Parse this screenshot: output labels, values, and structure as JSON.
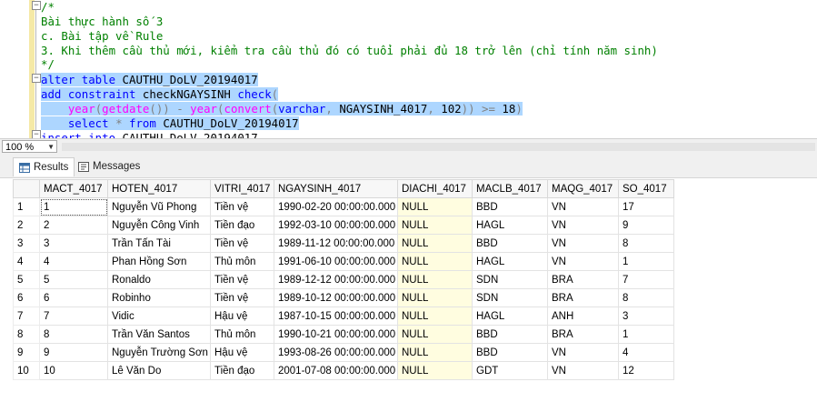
{
  "editor": {
    "lines": [
      {
        "text": "/*",
        "style": "cmt",
        "selected": false
      },
      {
        "text": "Bài thực hành số 3",
        "style": "cmt",
        "selected": false
      },
      {
        "text": "c. Bài tập về Rule",
        "style": "cmt",
        "selected": false
      },
      {
        "text": "3. Khi thêm cầu thủ mới, kiểm tra cầu thủ đó có tuổi phải đủ 18 trở lên (chỉ tính năm sinh)",
        "style": "cmt",
        "selected": false
      },
      {
        "text": "*/",
        "style": "cmt",
        "selected": false
      }
    ],
    "sql": {
      "l1_kw": "alter table",
      "l1_obj": "CAUTHU_DoLV_20194017",
      "l2_kw": "add constraint",
      "l2_obj": "checkNGAYSINH",
      "l2_kw2": "check",
      "l2_paren": "(",
      "l3_fn1": "year",
      "l3_p1": "(",
      "l3_fn2": "getdate",
      "l3_p2": "())",
      "l3_op": "-",
      "l3_fn3": "year",
      "l3_p3": "(",
      "l3_fn4": "convert",
      "l3_p4": "(",
      "l3_kw": "varchar",
      "l3_p5": ",",
      "l3_obj": "NGAYSINH_4017",
      "l3_p6": ",",
      "l3_num": "102",
      "l3_p7": "))",
      "l3_ge": ">=",
      "l3_num2": "18",
      "l3_p8": ")",
      "l4_kw": "select",
      "l4_star": "*",
      "l4_kw2": "from",
      "l4_obj": "CAUTHU_DoLV_20194017",
      "l5_kw": "insert into",
      "l5_obj": "CAUTHU_DoLV_20194017"
    },
    "zoom": "100 %"
  },
  "tabs": {
    "results": "Results",
    "messages": "Messages"
  },
  "grid": {
    "columns": [
      "MACT_4017",
      "HOTEN_4017",
      "VITRI_4017",
      "NGAYSINH_4017",
      "DIACHI_4017",
      "MACLB_4017",
      "MAQG_4017",
      "SO_4017"
    ],
    "rows": [
      {
        "n": "1",
        "cells": [
          "1",
          "Nguyễn Vũ Phong",
          "Tiền vệ",
          "1990-02-20 00:00:00.000",
          "NULL",
          "BBD",
          "VN",
          "17"
        ]
      },
      {
        "n": "2",
        "cells": [
          "2",
          "Nguyễn Công Vinh",
          "Tiền đạo",
          "1992-03-10 00:00:00.000",
          "NULL",
          "HAGL",
          "VN",
          "9"
        ]
      },
      {
        "n": "3",
        "cells": [
          "3",
          "Trần Tấn Tài",
          "Tiền vệ",
          "1989-11-12 00:00:00.000",
          "NULL",
          "BBD",
          "VN",
          "8"
        ]
      },
      {
        "n": "4",
        "cells": [
          "4",
          "Phan Hồng Sơn",
          "Thủ môn",
          "1991-06-10 00:00:00.000",
          "NULL",
          "HAGL",
          "VN",
          "1"
        ]
      },
      {
        "n": "5",
        "cells": [
          "5",
          "Ronaldo",
          "Tiền vệ",
          "1989-12-12 00:00:00.000",
          "NULL",
          "SDN",
          "BRA",
          "7"
        ]
      },
      {
        "n": "6",
        "cells": [
          "6",
          "Robinho",
          "Tiền vệ",
          "1989-10-12 00:00:00.000",
          "NULL",
          "SDN",
          "BRA",
          "8"
        ]
      },
      {
        "n": "7",
        "cells": [
          "7",
          "Vidic",
          "Hậu vệ",
          "1987-10-15 00:00:00.000",
          "NULL",
          "HAGL",
          "ANH",
          "3"
        ]
      },
      {
        "n": "8",
        "cells": [
          "8",
          "Trần Văn Santos",
          "Thủ môn",
          "1990-10-21 00:00:00.000",
          "NULL",
          "BBD",
          "BRA",
          "1"
        ]
      },
      {
        "n": "9",
        "cells": [
          "9",
          "Nguyễn Trường Sơn",
          "Hậu vệ",
          "1993-08-26 00:00:00.000",
          "NULL",
          "BBD",
          "VN",
          "4"
        ]
      },
      {
        "n": "10",
        "cells": [
          "10",
          "Lê Văn Do",
          "Tiền đạo",
          "2001-07-08 00:00:00.000",
          "NULL",
          "GDT",
          "VN",
          "12"
        ]
      }
    ]
  }
}
